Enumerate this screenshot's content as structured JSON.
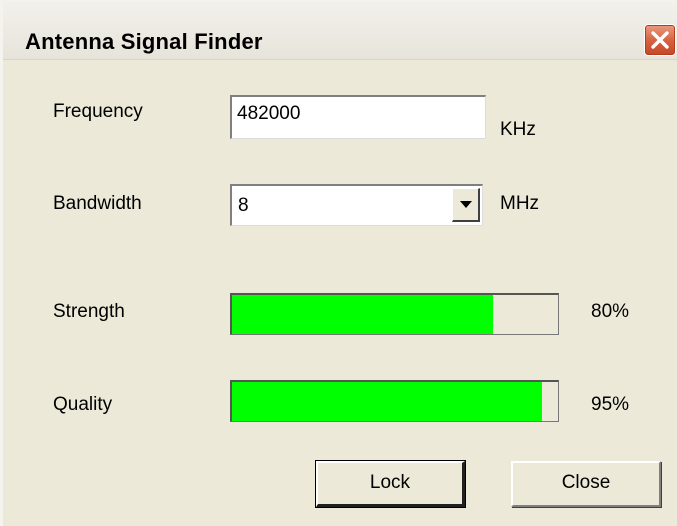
{
  "window": {
    "title": "Antenna Signal Finder"
  },
  "frequency": {
    "label": "Frequency",
    "value": "482000",
    "unit": "KHz"
  },
  "bandwidth": {
    "label": "Bandwidth",
    "value": "8",
    "unit": "MHz"
  },
  "strength": {
    "label": "Strength",
    "percent_text": "80%",
    "level": 0.8
  },
  "quality": {
    "label": "Quality",
    "percent_text": "95%",
    "level": 0.95
  },
  "buttons": {
    "lock": "Lock",
    "close": "Close"
  },
  "colors": {
    "meter_fill": "#00ff00",
    "close_button": "#d5603c",
    "dialog_background": "#ece9d8"
  },
  "icons": {
    "title_close": "close-x-icon",
    "dropdown": "chevron-down-icon"
  }
}
